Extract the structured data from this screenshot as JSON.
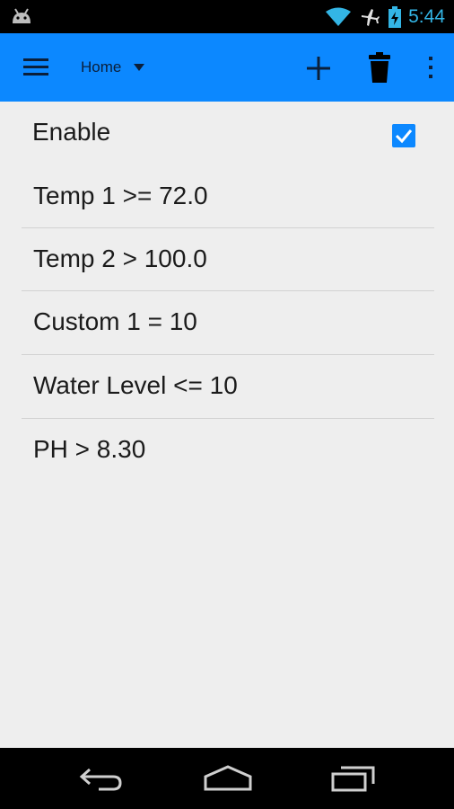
{
  "status_bar": {
    "time": "5:44",
    "icons": [
      "android-icon",
      "wifi-icon",
      "airplane-icon",
      "battery-charging-icon"
    ],
    "accent_color": "#33b5e5"
  },
  "action_bar": {
    "background_color": "#0c88ff",
    "spinner_selected": "Home",
    "icons": [
      "menu-icon",
      "add-icon",
      "trash-icon",
      "overflow-icon"
    ]
  },
  "enable": {
    "label": "Enable",
    "checked": true
  },
  "conditions": [
    {
      "label": "Temp 1 >= 72.0"
    },
    {
      "label": "Temp 2 > 100.0"
    },
    {
      "label": "Custom 1 = 10"
    },
    {
      "label": "Water Level <= 10"
    },
    {
      "label": "PH > 8.30"
    }
  ],
  "nav_bar": {
    "icons": [
      "back-icon",
      "home-icon",
      "recents-icon"
    ]
  }
}
